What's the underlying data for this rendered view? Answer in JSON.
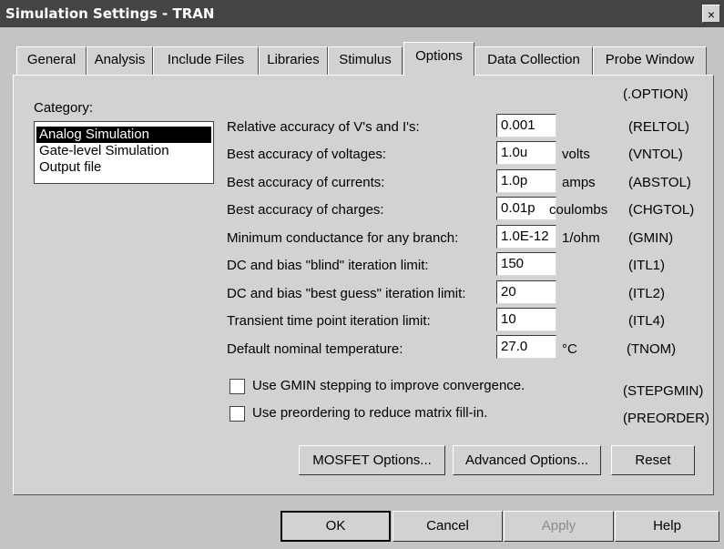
{
  "window": {
    "title": "Simulation Settings - TRAN",
    "close_label": "×"
  },
  "tabs": [
    {
      "label": "General"
    },
    {
      "label": "Analysis"
    },
    {
      "label": "Include Files"
    },
    {
      "label": "Libraries"
    },
    {
      "label": "Stimulus"
    },
    {
      "label": "Options",
      "active": true
    },
    {
      "label": "Data Collection"
    },
    {
      "label": "Probe Window"
    }
  ],
  "category": {
    "label": "Category:",
    "items": [
      "Analog Simulation",
      "Gate-level Simulation",
      "Output file"
    ],
    "selected": "Analog Simulation"
  },
  "option_header": "(.OPTION)",
  "options": [
    {
      "label": "Relative accuracy of V's and I's:",
      "value": "0.001",
      "unit": "",
      "code": "(RELTOL)"
    },
    {
      "label": "Best accuracy of voltages:",
      "value": "1.0u",
      "unit": "volts",
      "code": "(VNTOL)"
    },
    {
      "label": "Best accuracy of currents:",
      "value": "1.0p",
      "unit": "amps",
      "code": "(ABSTOL)"
    },
    {
      "label": "Best accuracy of charges:",
      "value": "0.01p",
      "unit": "coulombs",
      "code": "(CHGTOL)"
    },
    {
      "label": "Minimum conductance for any branch:",
      "value": "1.0E-12",
      "unit": "1/ohm",
      "code": "(GMIN)"
    },
    {
      "label": "DC and bias \"blind\" iteration limit:",
      "value": "150",
      "unit": "",
      "code": "(ITL1)"
    },
    {
      "label": "DC and bias \"best guess\" iteration limit:",
      "value": "20",
      "unit": "",
      "code": "(ITL2)"
    },
    {
      "label": "Transient time point iteration limit:",
      "value": "10",
      "unit": "",
      "code": "(ITL4)"
    },
    {
      "label": "Default nominal temperature:",
      "value": "27.0",
      "unit": "°C",
      "code": "(TNOM)"
    }
  ],
  "checkboxes": [
    {
      "label": "Use GMIN stepping to improve convergence.",
      "code": "(STEPGMIN)",
      "checked": false
    },
    {
      "label": "Use preordering to reduce matrix fill-in.",
      "code": "(PREORDER)",
      "checked": false
    }
  ],
  "panel_buttons": {
    "mosfet": "MOSFET Options...",
    "advanced": "Advanced Options...",
    "reset": "Reset"
  },
  "dialog_buttons": {
    "ok": "OK",
    "cancel": "Cancel",
    "apply": "Apply",
    "help": "Help"
  }
}
